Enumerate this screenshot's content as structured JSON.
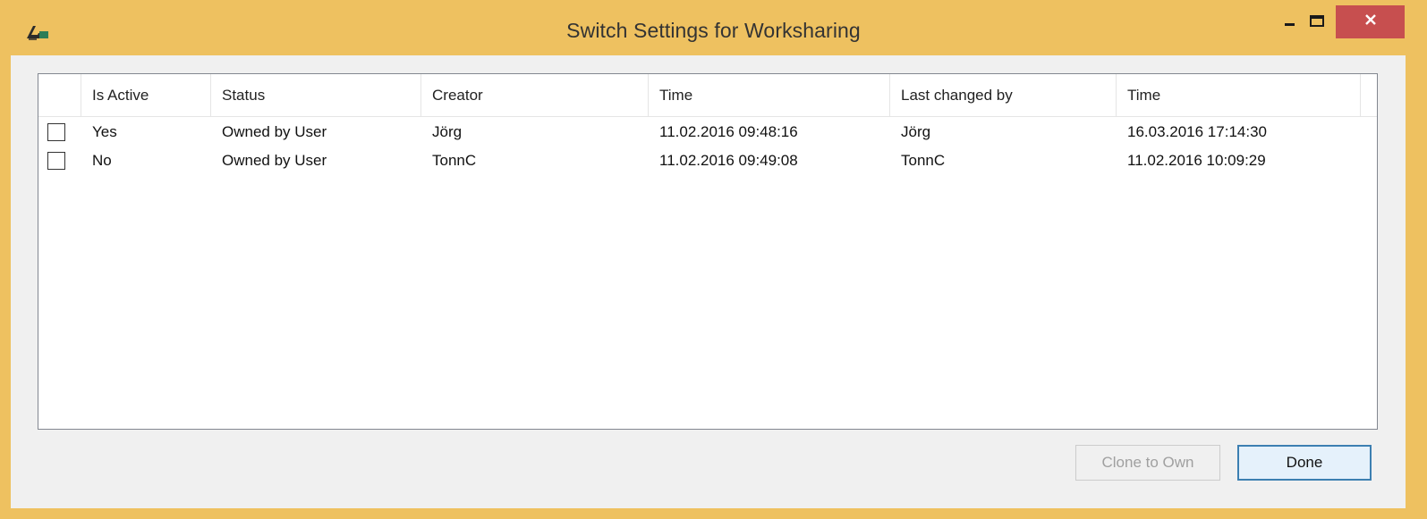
{
  "window": {
    "title": "Switch Settings for Worksharing",
    "accent_color": "#eec160",
    "close_color": "#c74f4f"
  },
  "grid": {
    "columns": [
      "",
      "Is Active",
      "Status",
      "Creator",
      "Time",
      "Last changed by",
      "Time"
    ],
    "rows": [
      {
        "checked": false,
        "is_active": "Yes",
        "status": "Owned by User",
        "creator": "Jörg",
        "time": "11.02.2016 09:48:16",
        "last_changed_by": "Jörg",
        "last_changed_time": "16.03.2016 17:14:30"
      },
      {
        "checked": false,
        "is_active": "No",
        "status": "Owned by User",
        "creator": "TonnC",
        "time": "11.02.2016 09:49:08",
        "last_changed_by": "TonnC",
        "last_changed_time": "11.02.2016 10:09:29"
      }
    ]
  },
  "buttons": {
    "clone_label": "Clone to Own",
    "clone_enabled": false,
    "done_label": "Done"
  },
  "icons": {
    "app": "app-logo-icon",
    "minimize": "minimize-icon",
    "maximize": "maximize-icon",
    "close": "close-icon"
  }
}
